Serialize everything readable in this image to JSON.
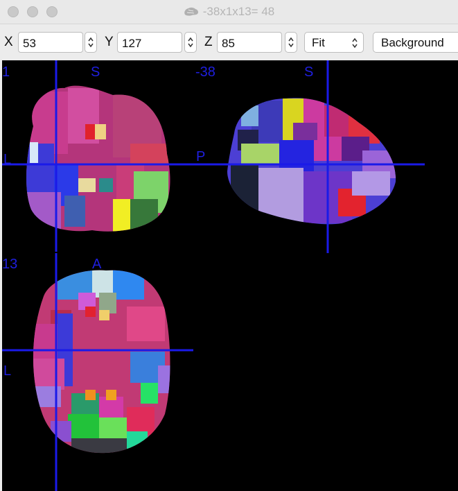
{
  "window": {
    "title": "-38x1x13= 48",
    "title_icon": "brain-icon"
  },
  "toolbar": {
    "x_label": "X",
    "x_value": "53",
    "y_label": "Y",
    "y_value": "127",
    "z_label": "Z",
    "z_value": "85",
    "zoom_value": "Fit",
    "background_label": "Background"
  },
  "viewer": {
    "coronal": {
      "slice": "1",
      "top": "S",
      "left": "L"
    },
    "sagittal": {
      "slice": "-38",
      "top": "S",
      "left": "P"
    },
    "axial": {
      "slice": "13",
      "top": "A",
      "left": "L"
    },
    "crosshair_color": "#1a1ae8",
    "label_color": "#1f1fe0"
  }
}
